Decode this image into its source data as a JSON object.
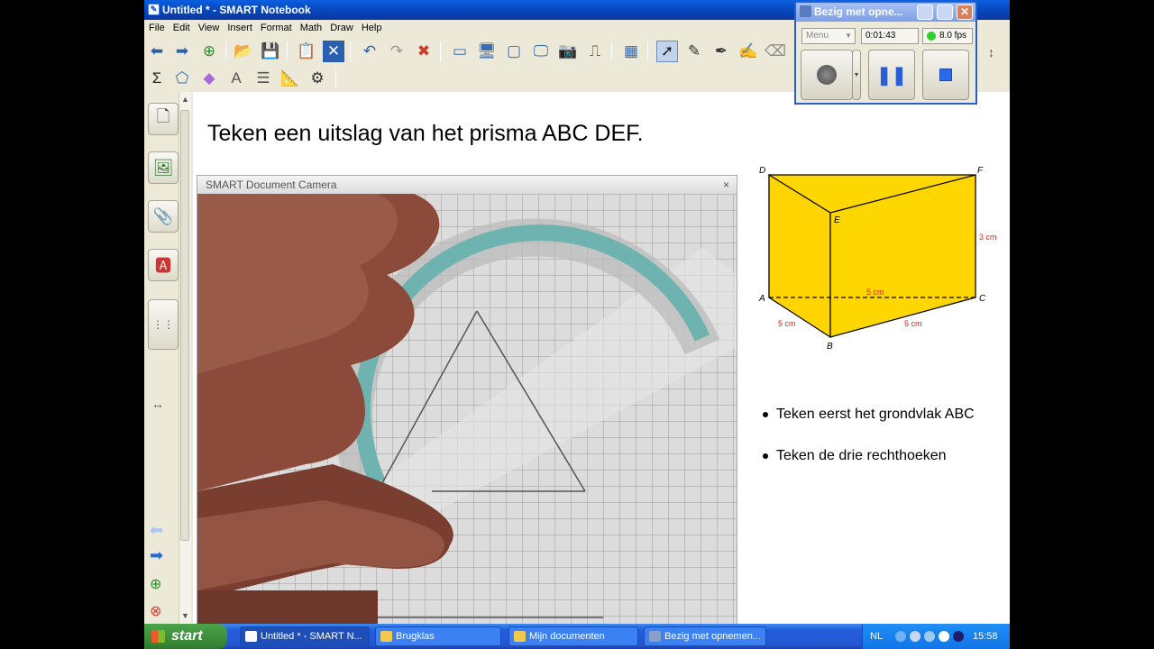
{
  "window": {
    "title": "Untitled * - SMART Notebook"
  },
  "menu": [
    "File",
    "Edit",
    "View",
    "Insert",
    "Format",
    "Math",
    "Draw",
    "Help"
  ],
  "page": {
    "heading": "Teken een uitslag van het prisma ABC DEF.",
    "bullets": [
      "Teken eerst het grondvlak ABC",
      "Teken de drie rechthoeken"
    ]
  },
  "camera": {
    "title": "SMART Document Camera",
    "close": "×"
  },
  "prism": {
    "vertices": {
      "D": "D",
      "F": "F",
      "E": "E",
      "A": "A",
      "C": "C",
      "B": "B"
    },
    "dimensions": {
      "height": "3 cm",
      "ac": "5 cm",
      "ab": "5 cm",
      "bc": "5 cm"
    },
    "colors": {
      "fill": "#ffd700",
      "edge": "#000000",
      "dimension": "#e0241b"
    }
  },
  "recorder": {
    "title": "Bezig met opne...",
    "menu": "Menu",
    "time": "0:01:43",
    "fps": "8.0 fps"
  },
  "taskbar": {
    "start": "start",
    "tasks": [
      "Untitled * - SMART N...",
      "Brugklas",
      "Mijn documenten",
      "Bezig met opnemen..."
    ],
    "language": "NL",
    "clock": "15:58"
  }
}
